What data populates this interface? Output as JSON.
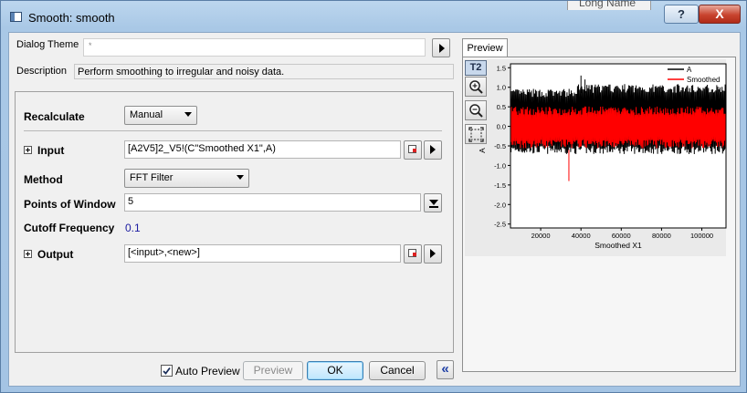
{
  "window": {
    "title": "Smooth: smooth",
    "background_header": "Long Name",
    "help_glyph": "?",
    "close_glyph": "X"
  },
  "theme": {
    "label": "Dialog Theme",
    "value": "*"
  },
  "description": {
    "label": "Description",
    "text": "Perform smoothing to irregular and noisy data."
  },
  "form": {
    "recalculate": {
      "label": "Recalculate",
      "value": "Manual"
    },
    "input": {
      "label": "Input",
      "value": "[A2V5]2_V5!(C\"Smoothed X1\",A)"
    },
    "method": {
      "label": "Method",
      "value": "FFT Filter"
    },
    "points": {
      "label": "Points of Window",
      "value": "5"
    },
    "cutoff": {
      "label": "Cutoff Frequency",
      "value": "0.1"
    },
    "output": {
      "label": "Output",
      "value": "[<input>,<new>]"
    }
  },
  "buttons": {
    "auto_preview": "Auto Preview",
    "auto_preview_checked": true,
    "preview": "Preview",
    "ok": "OK",
    "cancel": "Cancel",
    "collapse_glyph": "«"
  },
  "preview_panel": {
    "tab_label": "Preview",
    "toolbar": {
      "t2_label": "T2"
    }
  },
  "chart_data": {
    "type": "line",
    "xlabel": "Smoothed X1",
    "ylabel": "A",
    "xlim": [
      5000,
      112000
    ],
    "ylim": [
      -2.6,
      1.6
    ],
    "xticks": [
      20000,
      40000,
      60000,
      80000,
      100000
    ],
    "yticks": [
      -2.5,
      -2.0,
      -1.5,
      -1.0,
      -0.5,
      0.0,
      0.5,
      1.0,
      1.5
    ],
    "ytick_labels": [
      "-2.5",
      "-2.0",
      "-1.5",
      "-1.0",
      "-0.5",
      "0.0",
      "0.5",
      "1.0",
      "1.5"
    ],
    "legend": {
      "placement": "top-right"
    },
    "series": [
      {
        "name": "A",
        "color": "#000000",
        "band_upper": 0.85,
        "band_lower": -0.6
      },
      {
        "name": "Smoothed",
        "color": "#ff0000",
        "band_upper": 0.4,
        "band_lower": -0.45
      }
    ],
    "spikes": [
      {
        "series": "A",
        "x": 34000,
        "y": -1.4
      },
      {
        "series": "A",
        "x": 40000,
        "y": 1.3
      },
      {
        "series": "A",
        "x": 42000,
        "y": 1.2
      }
    ]
  },
  "colors": {
    "cutoff_value": "#1a1aa0",
    "series_a": "#000000",
    "series_smoothed": "#ff0000"
  }
}
